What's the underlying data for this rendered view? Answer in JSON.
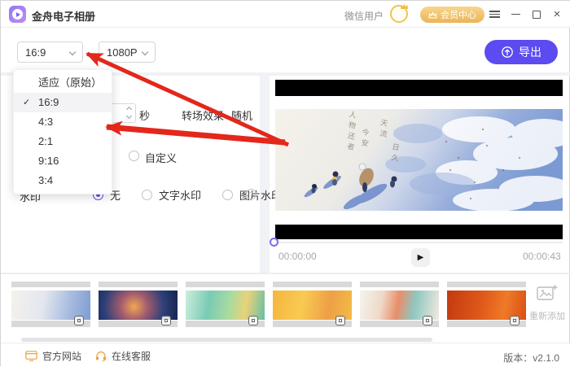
{
  "titlebar": {
    "app_title": "金舟电子相册",
    "user_name": "微信用户",
    "member_center_label": "会员中心"
  },
  "toolbar": {
    "aspect_ratio_value": "16:9",
    "resolution_value": "1080P",
    "export_label": "导出"
  },
  "ratio_dropdown": {
    "items": [
      {
        "label": "适应（原始）",
        "selected": false
      },
      {
        "label": "16:9",
        "selected": true
      },
      {
        "label": "4:3",
        "selected": false
      },
      {
        "label": "2:1",
        "selected": false
      },
      {
        "label": "9:16",
        "selected": false
      },
      {
        "label": "3:4",
        "selected": false
      }
    ]
  },
  "settings": {
    "duration_unit": "秒",
    "transition_label": "转场效果",
    "transition_value": "随机",
    "custom_option_label": "自定义",
    "watermark_label": "水印",
    "watermark_options": [
      {
        "label": "无",
        "selected": true
      },
      {
        "label": "文字水印",
        "selected": false
      },
      {
        "label": "图片水印",
        "selected": false
      }
    ]
  },
  "player": {
    "current_time": "00:00:00",
    "total_time": "00:00:43"
  },
  "thumbnails": {
    "readd_label": "重新添加",
    "items": [
      {
        "name": "page-1-snow",
        "background": "linear-gradient(100deg,#f4f2ec 0%,#e3e7ee 40%,#a9bce0 72%,#7e9cd2 100%)"
      },
      {
        "name": "page-2-night",
        "background": "radial-gradient(circle at 45% 55%,#f2a654 0%,#a05a6e 30%,#2c3f78 65%,#17234e 100%)"
      },
      {
        "name": "page-3-garden",
        "background": "linear-gradient(100deg,#cdeede 0%,#79cbb4 30%,#a8dba0 55%,#e8d27a 75%,#66bfa4 100%)"
      },
      {
        "name": "page-4-yellow",
        "background": "linear-gradient(100deg,#f5b63f 0%,#f9ca52 38%,#ef9f46 70%,#f3bc45 100%)"
      },
      {
        "name": "page-5-collage",
        "background": "linear-gradient(100deg,#f6f3ef 0%,#eed9c8 28%,#e88f6a 48%,#8fc7c0 68%,#f2e9df 100%)"
      },
      {
        "name": "page-6-poster",
        "background": "linear-gradient(100deg,#c23a10 0%,#e05a1a 45%,#ef7a28 72%,#d94f14 100%)"
      }
    ]
  },
  "footer": {
    "official_site_label": "官方网站",
    "support_label": "在线客服",
    "version_text": "版本：v2.1.0"
  },
  "icons": {
    "check": "✓",
    "play": "▶",
    "help": "?",
    "close": "×"
  },
  "colors": {
    "accent_purple": "#5b4bf0",
    "member_gold": "#eeb457",
    "arrow_red": "#e3271b"
  }
}
